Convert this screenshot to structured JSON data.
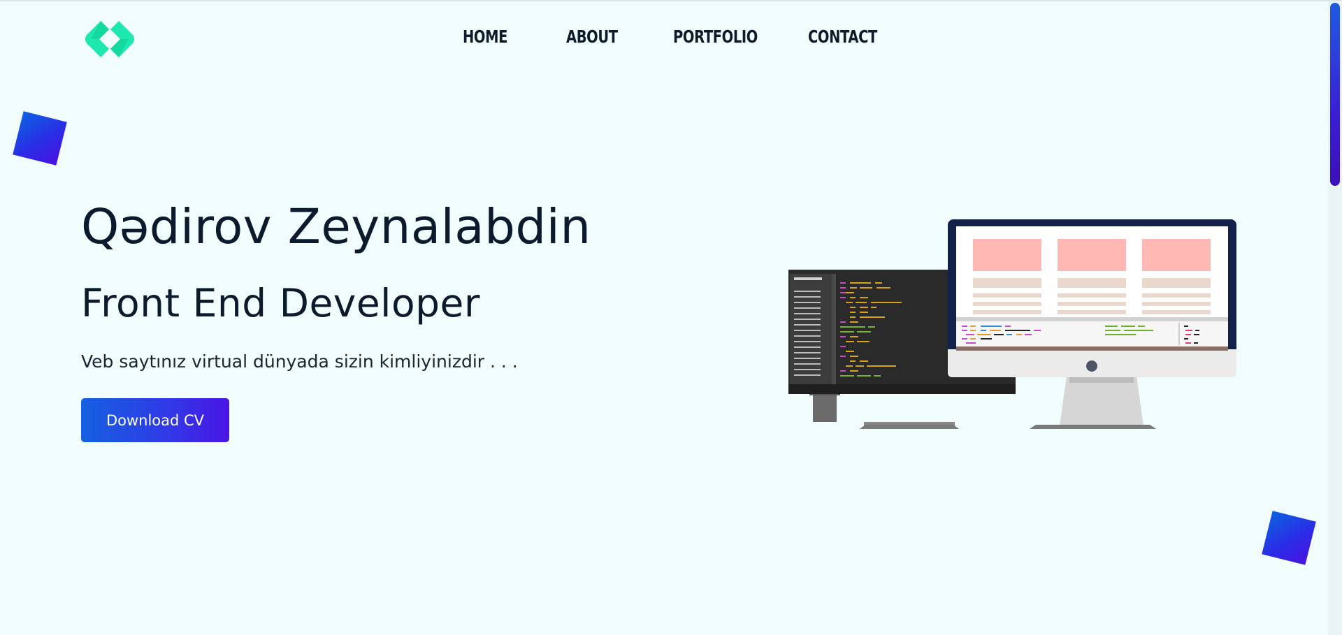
{
  "header": {
    "logo_icon": "code-brackets-icon",
    "logo_color": "#1ee8b0",
    "nav": [
      {
        "label": "HOME"
      },
      {
        "label": "ABOUT"
      },
      {
        "label": "PORTFOLIO"
      },
      {
        "label": "CONTACT"
      }
    ]
  },
  "hero": {
    "name": "Qədirov Zeynalabdin",
    "role": "Front End Developer",
    "tagline": "Veb saytınız virtual dünyada sizin kimliyinizdir . . .",
    "cta_label": "Download CV",
    "illustration_icon": "developer-monitors-icon"
  },
  "colors": {
    "background": "#f1fcfd",
    "text": "#0d1b2a",
    "accent_start": "#1560e0",
    "accent_end": "#4a15e6"
  }
}
